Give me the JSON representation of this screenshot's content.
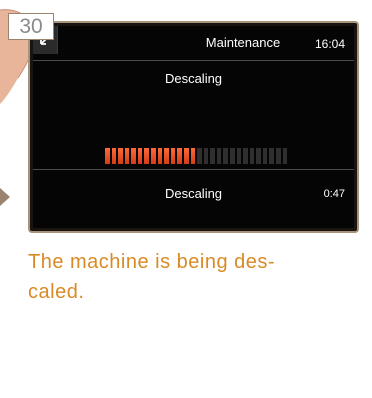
{
  "step_number": "30",
  "screen": {
    "header": {
      "title": "Maintenance",
      "time": "16:04",
      "back_icon": "back-arrow-icon"
    },
    "process_name": "Descaling",
    "progress": {
      "total_segments": 28,
      "filled_segments": 14,
      "fraction": 0.5
    },
    "status": {
      "label": "Descaling",
      "remaining_time": "0:47"
    }
  },
  "caption": {
    "line1": "The machine is being des-",
    "line2": "caled."
  },
  "colors": {
    "progress_fill": "#e84a1f",
    "progress_empty": "#2f2f2f",
    "caption_text": "#d98a25",
    "frame": "#a8937c"
  }
}
